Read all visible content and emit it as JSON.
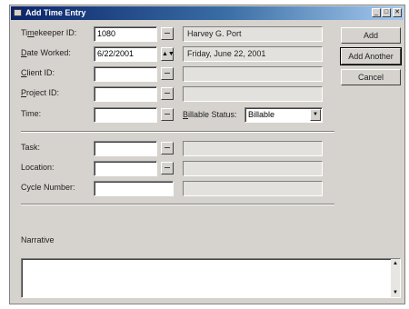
{
  "window": {
    "title": "Add Time Entry",
    "icon": "window-app-icon",
    "controls": {
      "minimize": "_",
      "maximize": "□",
      "close": "✕"
    }
  },
  "fields": {
    "timekeeper_id": {
      "prefix": "Ti",
      "accel": "m",
      "rest": "ekeeper ID:",
      "value": "1080",
      "lookup": "Harvey G. Port"
    },
    "date_worked": {
      "prefix": "",
      "accel": "D",
      "rest": "ate Worked:",
      "value": "6/22/2001",
      "spin": "▲▼",
      "day": "Friday, June 22, 2001"
    },
    "client_id": {
      "prefix": "",
      "accel": "C",
      "rest": "lient ID:",
      "value": ""
    },
    "project_id": {
      "prefix": "",
      "accel": "P",
      "rest": "roject ID:",
      "value": ""
    },
    "time": {
      "label": "Time:",
      "value": ""
    },
    "billable_status": {
      "prefix": "",
      "accel": "B",
      "rest": "illable Status:",
      "value": "Billable",
      "arrow": "▼"
    },
    "task": {
      "label": "Task:",
      "value": ""
    },
    "location": {
      "label": "Location:",
      "value": ""
    },
    "cycle_number": {
      "label": "Cycle Number:",
      "value": ""
    },
    "narrative": {
      "label": "Narrative",
      "value": ""
    }
  },
  "buttons": {
    "add": "Add",
    "add_another": "Add Another",
    "cancel": "Cancel"
  },
  "scroll": {
    "up": "▲",
    "down": "▼"
  }
}
